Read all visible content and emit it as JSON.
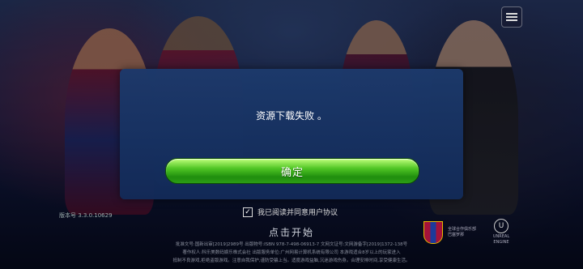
{
  "dialog": {
    "message": "资源下载失败 。",
    "confirm_label": "确定"
  },
  "version": "版本号 3.3.0.10629",
  "agreement": {
    "checked": true,
    "check_mark": "✓",
    "label": "我已阅读并同意用户协议"
  },
  "start_label": "点击开始",
  "legal_lines": [
    "批准文号:国新出审[2019]2989号  出版物号:ISBN 978-7-498-06913-7  文网文证号:文网游备字[2019]1372-138号",
    "著作权人:科乐美数码娱乐株式会社  出版服务单位:广州网易计算机系统有限公司  本游戏适合8岁以上的玩家进入",
    "抵制不良游戏,拒绝盗版游戏。注意自我保护,谨防受骗上当。适度游戏益脑,沉迷游戏伤身。合理安排时间,享受健康生活。"
  ],
  "logos": {
    "partner_text": "全球合作俱乐部 巴塞罗那",
    "engine_text": "UNREAL ENGINE",
    "engine_mark": "U"
  },
  "icons": {
    "menu": "menu-icon",
    "checkbox": "checkmark-icon",
    "club": "fcb-crest-icon"
  },
  "colors": {
    "dialog_bg": "#1c3a6c",
    "confirm_green": "#4fc524"
  }
}
